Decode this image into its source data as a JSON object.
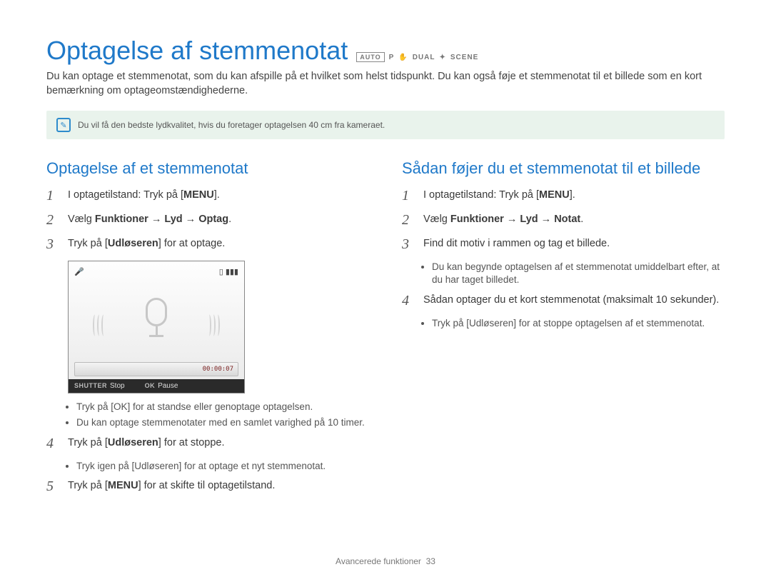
{
  "title": "Optagelse af stemmenotat",
  "mode_icons": {
    "auto": "AUTO",
    "p": "P",
    "dual": "DUAL",
    "scene": "SCENE"
  },
  "intro": "Du kan optage et stemmenotat, som du kan afspille på et hvilket som helst tidspunkt. Du kan også føje et stemmenotat til et billede som en kort bemærkning om optageomstændighederne.",
  "tip": "Du vil få den bedste lydkvalitet, hvis du foretager optagelsen 40 cm fra kameraet.",
  "left": {
    "heading": "Optagelse af et stemmenotat",
    "step1_pre": "I optagetilstand: Tryk på [",
    "step1_btn": "MENU",
    "step1_post": "].",
    "step2_pre": "Vælg ",
    "step2_b1": "Funktioner",
    "step2_arrow": " → ",
    "step2_b2": "Lyd",
    "step2_b3": "Optag",
    "step2_post": ".",
    "step3_pre": "Tryk på [",
    "step3_btn": "Udløseren",
    "step3_post": "] for at optage.",
    "screen": {
      "timer": "00:00:07",
      "shutter_label": "SHUTTER",
      "stop": "Stop",
      "ok_label": "OK",
      "pause": "Pause"
    },
    "bullets_a": [
      "Tryk på [OK] for at standse eller genoptage optagelsen.",
      "Du kan optage stemmenotater med en samlet varighed på 10 timer."
    ],
    "step4_pre": "Tryk på [",
    "step4_btn": "Udløseren",
    "step4_post": "] for at stoppe.",
    "bullets_b": [
      "Tryk igen på [Udløseren] for at optage et nyt stemmenotat."
    ],
    "step5_pre": "Tryk på [",
    "step5_btn": "MENU",
    "step5_post": "] for at skifte til optagetilstand."
  },
  "right": {
    "heading": "Sådan føjer du et stemmenotat til et billede",
    "step1_pre": "I optagetilstand: Tryk på [",
    "step1_btn": "MENU",
    "step1_post": "].",
    "step2_pre": "Vælg ",
    "step2_b1": "Funktioner",
    "step2_arrow": " → ",
    "step2_b2": "Lyd",
    "step2_b3": "Notat",
    "step2_post": ".",
    "step3": "Find dit motiv i rammen og tag et billede.",
    "bullets_a": [
      "Du kan begynde optagelsen af et stemmenotat umiddelbart efter, at du har taget billedet."
    ],
    "step4": "Sådan optager du et kort stemmenotat (maksimalt 10 sekunder).",
    "bullets_b": [
      "Tryk på [Udløseren] for at stoppe optagelsen af et stemmenotat."
    ]
  },
  "footer": {
    "section": "Avancerede funktioner",
    "page": "33"
  }
}
